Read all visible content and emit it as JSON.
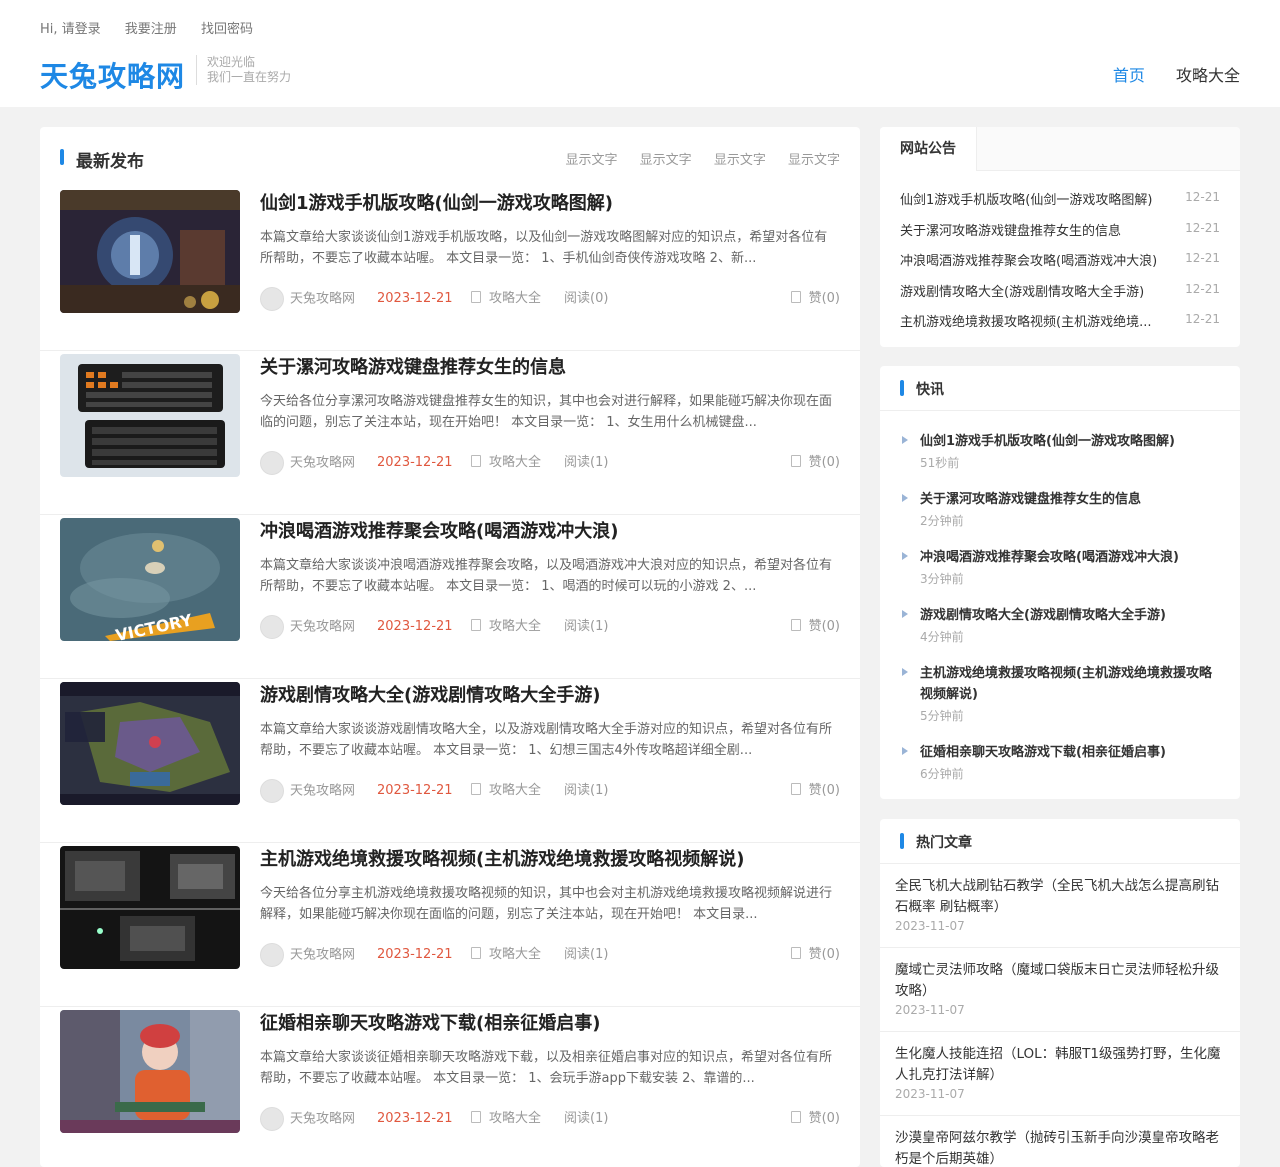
{
  "topbar": {
    "login": "Hi, 请登录",
    "register": "我要注册",
    "recover": "找回密码"
  },
  "logo": "天兔攻略网",
  "tagline": {
    "line1": "欢迎光临",
    "line2": "我们一直在努力"
  },
  "nav": {
    "home": "首页",
    "guides": "攻略大全"
  },
  "main": {
    "title": "最新发布",
    "tabs": [
      "显示文字",
      "显示文字",
      "显示文字",
      "显示文字"
    ],
    "articles": [
      {
        "title": "仙剑1游戏手机版攻略(仙剑一游戏攻略图解)",
        "desc": "本篇文章给大家谈谈仙剑1游戏手机版攻略，以及仙剑一游戏攻略图解对应的知识点，希望对各位有所帮助，不要忘了收藏本站喔。 本文目录一览： 1、手机仙剑奇侠传游戏攻略 2、新...",
        "author": "天兔攻略网",
        "date": "2023-12-21",
        "category": "攻略大全",
        "reads": "阅读(0)",
        "likes": "赞(0)"
      },
      {
        "title": "关于漯河攻略游戏键盘推荐女生的信息",
        "desc": "今天给各位分享漯河攻略游戏键盘推荐女生的知识，其中也会对进行解释，如果能碰巧解决你现在面临的问题，别忘了关注本站，现在开始吧！ 本文目录一览： 1、女生用什么机械键盘...",
        "author": "天兔攻略网",
        "date": "2023-12-21",
        "category": "攻略大全",
        "reads": "阅读(1)",
        "likes": "赞(0)"
      },
      {
        "title": "冲浪喝酒游戏推荐聚会攻略(喝酒游戏冲大浪)",
        "desc": "本篇文章给大家谈谈冲浪喝酒游戏推荐聚会攻略，以及喝酒游戏冲大浪对应的知识点，希望对各位有所帮助，不要忘了收藏本站喔。 本文目录一览： 1、喝酒的时候可以玩的小游戏 2、...",
        "author": "天兔攻略网",
        "date": "2023-12-21",
        "category": "攻略大全",
        "reads": "阅读(1)",
        "likes": "赞(0)"
      },
      {
        "title": "游戏剧情攻略大全(游戏剧情攻略大全手游)",
        "desc": "本篇文章给大家谈谈游戏剧情攻略大全，以及游戏剧情攻略大全手游对应的知识点，希望对各位有所帮助，不要忘了收藏本站喔。 本文目录一览： 1、幻想三国志4外传攻略超详细全剧...",
        "author": "天兔攻略网",
        "date": "2023-12-21",
        "category": "攻略大全",
        "reads": "阅读(1)",
        "likes": "赞(0)"
      },
      {
        "title": "主机游戏绝境救援攻略视频(主机游戏绝境救援攻略视频解说)",
        "desc": "今天给各位分享主机游戏绝境救援攻略视频的知识，其中也会对主机游戏绝境救援攻略视频解说进行解释，如果能碰巧解决你现在面临的问题，别忘了关注本站，现在开始吧！ 本文目录...",
        "author": "天兔攻略网",
        "date": "2023-12-21",
        "category": "攻略大全",
        "reads": "阅读(1)",
        "likes": "赞(0)"
      },
      {
        "title": "征婚相亲聊天攻略游戏下载(相亲征婚启事)",
        "desc": "本篇文章给大家谈谈征婚相亲聊天攻略游戏下载，以及相亲征婚启事对应的知识点，希望对各位有所帮助，不要忘了收藏本站喔。 本文目录一览： 1、会玩手游app下载安装 2、靠谱的...",
        "author": "天兔攻略网",
        "date": "2023-12-21",
        "category": "攻略大全",
        "reads": "阅读(1)",
        "likes": "赞(0)"
      }
    ]
  },
  "notice": {
    "title": "网站公告",
    "items": [
      {
        "title": "仙剑1游戏手机版攻略(仙剑一游戏攻略图解)",
        "date": "12-21"
      },
      {
        "title": "关于漯河攻略游戏键盘推荐女生的信息",
        "date": "12-21"
      },
      {
        "title": "冲浪喝酒游戏推荐聚会攻略(喝酒游戏冲大浪)",
        "date": "12-21"
      },
      {
        "title": "游戏剧情攻略大全(游戏剧情攻略大全手游)",
        "date": "12-21"
      },
      {
        "title": "主机游戏绝境救援攻略视频(主机游戏绝境...",
        "date": "12-21"
      }
    ]
  },
  "flash": {
    "title": "快讯",
    "items": [
      {
        "title": "仙剑1游戏手机版攻略(仙剑一游戏攻略图解)",
        "time": "51秒前"
      },
      {
        "title": "关于漯河攻略游戏键盘推荐女生的信息",
        "time": "2分钟前"
      },
      {
        "title": "冲浪喝酒游戏推荐聚会攻略(喝酒游戏冲大浪)",
        "time": "3分钟前"
      },
      {
        "title": "游戏剧情攻略大全(游戏剧情攻略大全手游)",
        "time": "4分钟前"
      },
      {
        "title": "主机游戏绝境救援攻略视频(主机游戏绝境救援攻略视频解说)",
        "time": "5分钟前"
      },
      {
        "title": "征婚相亲聊天攻略游戏下载(相亲征婚启事)",
        "time": "6分钟前"
      }
    ]
  },
  "hot": {
    "title": "热门文章",
    "items": [
      {
        "title": "全民飞机大战刷钻石教学（全民飞机大战怎么提高刷钻石概率 刷钻概率）",
        "date": "2023-11-07"
      },
      {
        "title": "魔域亡灵法师攻略（魔域口袋版末日亡灵法师轻松升级攻略）",
        "date": "2023-11-07"
      },
      {
        "title": "生化魔人技能连招（LOL：韩服T1级强势打野，生化魔人扎克打法详解）",
        "date": "2023-11-07"
      },
      {
        "title": "沙漠皇帝阿兹尔教学（抛砖引玉新手向沙漠皇帝攻略老朽是个后期英雄）",
        "date": ""
      }
    ]
  },
  "colors": {
    "accent": "#1e88e5",
    "date": "#e0583f"
  }
}
